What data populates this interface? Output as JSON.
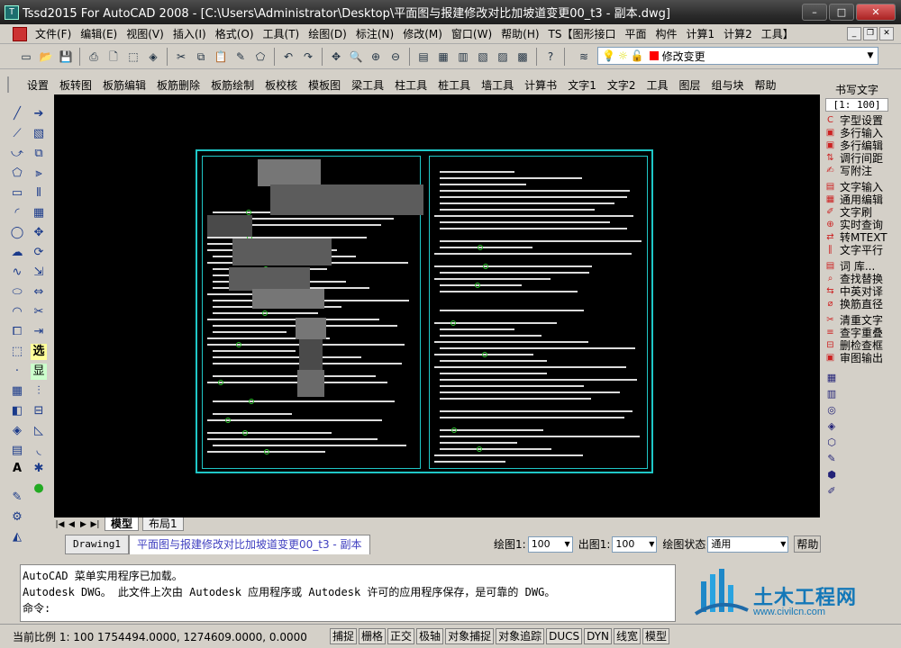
{
  "window": {
    "title": "Tssd2015 For AutoCAD 2008 - [C:\\Users\\Administrator\\Desktop\\平面图与报建修改对比加坡道变更00_t3 - 副本.dwg]",
    "icon": "tssd-app-icon",
    "buttons": [
      "–",
      "□",
      "✕"
    ]
  },
  "menu": [
    "文件(F)",
    "编辑(E)",
    "视图(V)",
    "插入(I)",
    "格式(O)",
    "工具(T)",
    "绘图(D)",
    "标注(N)",
    "修改(M)",
    "窗口(W)",
    "帮助(H)",
    "TS【图形接口",
    "平面",
    "构件",
    "计算1",
    "计算2",
    "工具】"
  ],
  "layer": {
    "current": "修改变更",
    "color": "#ff0000"
  },
  "tssd_toolbar": [
    "设置",
    "板转图",
    "板筋编辑",
    "板筋删除",
    "板筋绘制",
    "板校核",
    "模板图",
    "梁工具",
    "柱工具",
    "桩工具",
    "墙工具",
    "计算书",
    "文字1",
    "文字2",
    "工具",
    "图层",
    "组与块",
    "帮助"
  ],
  "left_toolbox": {
    "labels": [
      "选",
      "显",
      "A"
    ]
  },
  "layout_tabs": [
    "模型",
    "布局1"
  ],
  "doc_tabs": [
    "Drawing1",
    "平面图与报建修改对比加坡道变更00_t3 - 副本"
  ],
  "scale_bar": {
    "draw_label": "绘图1:",
    "draw_value": "100",
    "out_label": "出图1:",
    "out_value": "100",
    "state_label": "绘图状态",
    "state_value": "通用",
    "help": "帮助"
  },
  "command": {
    "lines": [
      "AutoCAD 菜单实用程序已加载。",
      "Autodesk DWG。  此文件上次由 Autodesk 应用程序或 Autodesk 许可的应用程序保存，是可靠的 DWG。"
    ],
    "prompt": "命令:"
  },
  "status": {
    "scale": "当前比例 1: 100",
    "coords": "1754494.0000, 1274609.0000, 0.0000",
    "buttons": [
      "捕捉",
      "栅格",
      "正交",
      "极轴",
      "对象捕捉",
      "对象追踪",
      "DUCS",
      "DYN",
      "线宽",
      "模型"
    ]
  },
  "right_panel": {
    "title": "书写文字",
    "scale": "[1: 100]",
    "items": [
      "字型设置",
      "多行输入",
      "多行编辑",
      "调行间距",
      "写附注",
      "文字输入",
      "通用编辑",
      "文字刷",
      "实时查询",
      "转MTEXT",
      "文字平行",
      "词  库...",
      "查找替换",
      "中英对译",
      "换筋直径",
      "清重文字",
      "查字重叠",
      "删检查框",
      "审图输出"
    ]
  },
  "watermark": {
    "text": "土木工程网",
    "url": "www.civilcn.com"
  }
}
